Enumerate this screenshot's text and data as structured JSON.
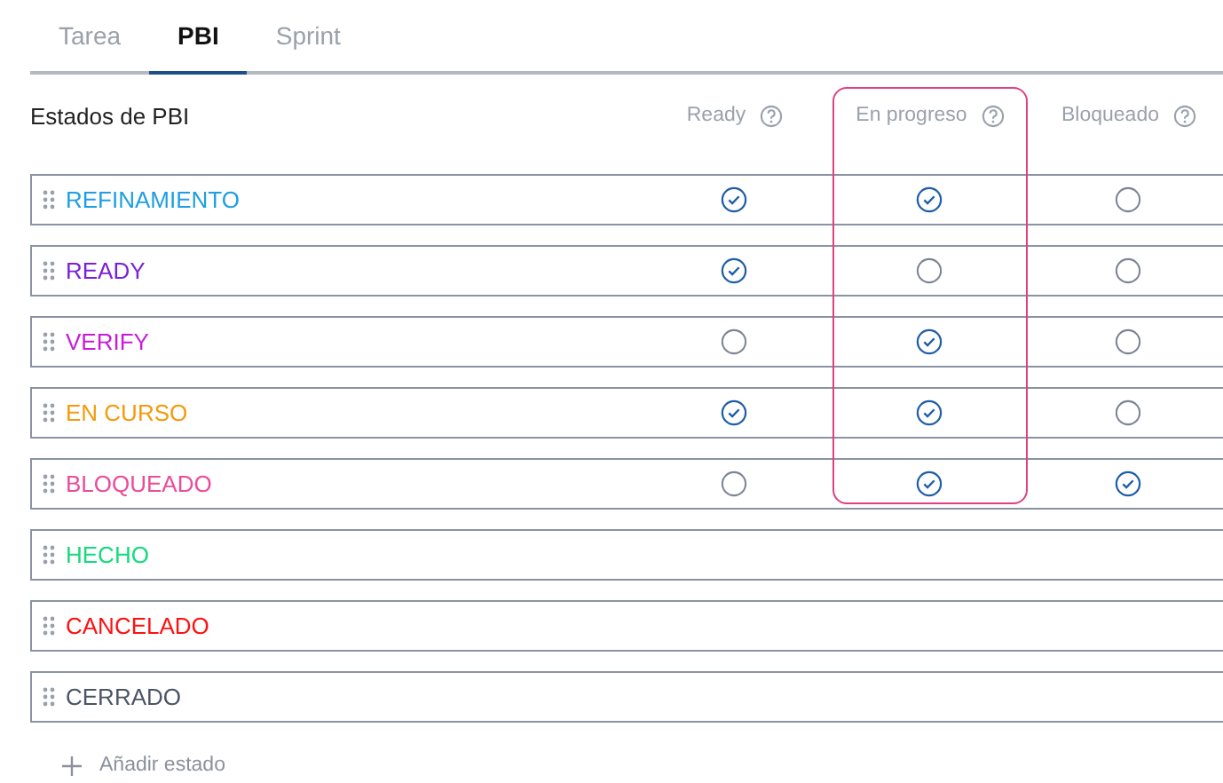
{
  "tabs": [
    {
      "label": "Tarea",
      "selected": false
    },
    {
      "label": "PBI",
      "selected": true
    },
    {
      "label": "Sprint",
      "selected": false
    }
  ],
  "table": {
    "title": "Estados de PBI",
    "columns": [
      {
        "label": "Ready",
        "highlighted": false
      },
      {
        "label": "En progreso",
        "highlighted": true
      },
      {
        "label": "Bloqueado",
        "highlighted": false
      }
    ],
    "rows": [
      {
        "name": "REFINAMIENTO",
        "color": "#1d9fe2",
        "checks": [
          true,
          true,
          false
        ]
      },
      {
        "name": "READY",
        "color": "#7a1fd8",
        "checks": [
          true,
          false,
          false
        ]
      },
      {
        "name": "VERIFY",
        "color": "#c81bd9",
        "checks": [
          false,
          true,
          false
        ]
      },
      {
        "name": "EN CURSO",
        "color": "#f59a0c",
        "checks": [
          true,
          true,
          false
        ]
      },
      {
        "name": "BLOQUEADO",
        "color": "#ec4b9b",
        "checks": [
          false,
          true,
          true
        ]
      },
      {
        "name": "HECHO",
        "color": "#14db7c"
      },
      {
        "name": "CANCELADO",
        "color": "#ff1010"
      },
      {
        "name": "CERRADO",
        "color": "#4b5563"
      }
    ]
  },
  "add_button": "Añadir estado"
}
